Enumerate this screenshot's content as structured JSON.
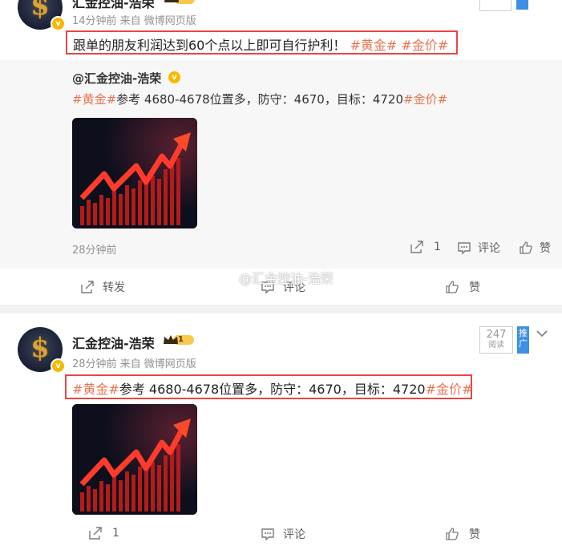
{
  "post1": {
    "author": "汇金控油-浩荣",
    "meta": "14分钟前 来自 微博网页版",
    "content_text": "跟单的朋友利润达到60个点以上即可自行护利！",
    "tags": [
      "#黄金#",
      "#金价#"
    ],
    "repost": {
      "author": "@汇金控油-浩荣",
      "tag1": "#黄金#",
      "text": "参考 4680-4678位置多，防守：4670，目标：4720",
      "tag2": "#金价#",
      "time": "28分钟前",
      "forward_count": "1",
      "comment_label": "评论",
      "like_label": "赞"
    },
    "actions": {
      "forward": "转发",
      "comment": "评论",
      "like": "赞"
    }
  },
  "post2": {
    "author": "汇金控油-浩荣",
    "level_badge": "1",
    "meta": "28分钟前 来自 微博网页版",
    "tag1": "#黄金#",
    "content_text": "参考 4680-4678位置多，防守：4670，目标：4720",
    "tag2": "#金价#",
    "read_count": "247",
    "read_label": "阅读",
    "promo_label": "推广",
    "actions": {
      "forward": "1",
      "comment": "评论",
      "like": "赞"
    }
  },
  "watermark": "@汇金控油-浩荣",
  "colors": {
    "tag": "#eb7350",
    "highlight_box": "#e84545",
    "verified": "#f6b800",
    "promo": "#3b90e5"
  }
}
